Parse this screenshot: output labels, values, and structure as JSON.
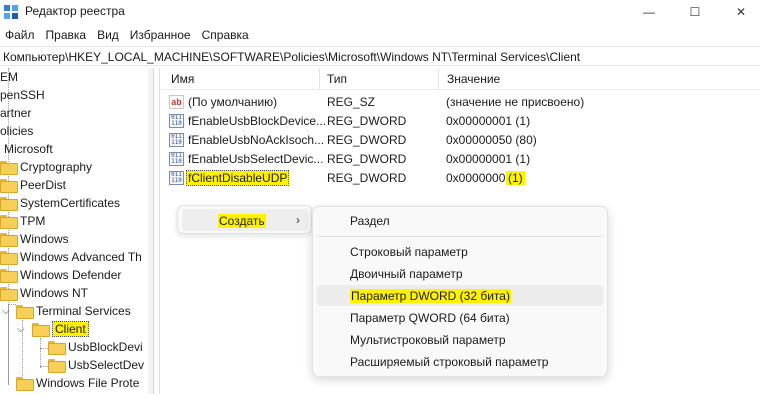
{
  "window": {
    "title": "Редактор реестра",
    "controls": {
      "minimize": "—",
      "maximize": "☐",
      "close": "✕"
    }
  },
  "menu": [
    "Файл",
    "Правка",
    "Вид",
    "Избранное",
    "Справка"
  ],
  "address": "Компьютер\\HKEY_LOCAL_MACHINE\\SOFTWARE\\Policies\\Microsoft\\Windows NT\\Terminal Services\\Client",
  "tree": {
    "items": [
      {
        "label": "EM",
        "expanded": false
      },
      {
        "label": "penSSH",
        "expanded": false
      },
      {
        "label": "artner",
        "expanded": false
      },
      {
        "label": "olicies",
        "expanded": true
      },
      {
        "label": "Microsoft",
        "expanded": true
      },
      {
        "label": "Cryptography"
      },
      {
        "label": "PeerDist"
      },
      {
        "label": "SystemCertificates"
      },
      {
        "label": "TPM"
      },
      {
        "label": "Windows"
      },
      {
        "label": "Windows Advanced Th"
      },
      {
        "label": "Windows Defender"
      },
      {
        "label": "Windows NT"
      },
      {
        "label": "Terminal Services"
      },
      {
        "label": "Client",
        "selected": true
      },
      {
        "label": "UsbBlockDevi"
      },
      {
        "label": "UsbSelectDev"
      },
      {
        "label": "Windows File Prote"
      }
    ]
  },
  "list": {
    "columns": {
      "name": "Имя",
      "type": "Тип",
      "value": "Значение"
    },
    "rows": [
      {
        "icon": "string-value-icon",
        "name": "(По умолчанию)",
        "type": "REG_SZ",
        "value": "(значение не присвоено)"
      },
      {
        "icon": "dword-value-icon",
        "name": "fEnableUsbBlockDevice...",
        "type": "REG_DWORD",
        "value": "0x00000001 (1)"
      },
      {
        "icon": "dword-value-icon",
        "name": "fEnableUsbNoAckIsoch...",
        "type": "REG_DWORD",
        "value": "0x00000050 (80)"
      },
      {
        "icon": "dword-value-icon",
        "name": "fEnableUsbSelectDevic...",
        "type": "REG_DWORD",
        "value": "0x00000001 (1)"
      },
      {
        "icon": "dword-value-icon",
        "name": "fClientDisableUDP",
        "type": "REG_DWORD",
        "value_main": "0x00000001",
        "value_hl": "(1)"
      }
    ]
  },
  "context_menu": {
    "item": "Создать",
    "arrow": "›"
  },
  "submenu": {
    "items": [
      {
        "label": "Раздел"
      },
      {
        "label": "Строковый параметр"
      },
      {
        "label": "Двоичный параметр"
      },
      {
        "label": "Параметр DWORD (32 бита)",
        "active": true
      },
      {
        "label": "Параметр QWORD (64 бита)"
      },
      {
        "label": "Мультистроковый параметр"
      },
      {
        "label": "Расширяемый строковый параметр"
      }
    ]
  },
  "colors": {
    "highlight": "#fff200",
    "folder": "#f5cf58"
  }
}
